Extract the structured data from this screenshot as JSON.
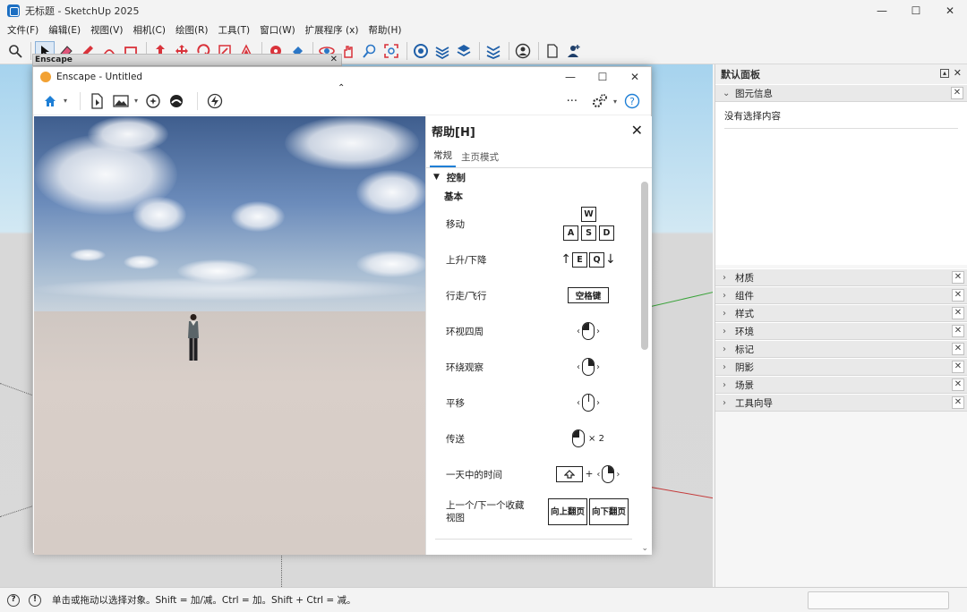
{
  "window": {
    "title": "无标题 - SketchUp 2025",
    "controls": [
      "—",
      "☐",
      "✕"
    ]
  },
  "menu": [
    "文件(F)",
    "编辑(E)",
    "视图(V)",
    "相机(C)",
    "绘图(R)",
    "工具(T)",
    "窗口(W)",
    "扩展程序 (x)",
    "帮助(H)"
  ],
  "toolbar_icons": [
    "magnifier-icon",
    "select-arrow-icon",
    "eraser-icon",
    "pencil-icon",
    "arc-icon",
    "rectangle-icon",
    "pushpull-icon",
    "move-icon",
    "rotate-icon",
    "scale-icon",
    "offset-icon",
    "tape-icon",
    "paint-icon",
    "orbit-icon",
    "pan-icon",
    "zoom-icon",
    "zoom-extents-icon",
    "warehouse-icon",
    "extension-icon",
    "layers-icon",
    "stack-icon",
    "user-icon",
    "document-icon",
    "add-user-icon"
  ],
  "enscape_mini": {
    "title": "Enscape"
  },
  "enscape": {
    "title": "Enscape - Untitled",
    "more": "···",
    "help": {
      "title": "帮助[H]",
      "tabs": [
        "常规",
        "主页模式"
      ],
      "section": "控制",
      "subsection": "基本",
      "rows": [
        {
          "label": "移动",
          "keys": [
            "W",
            "A",
            "S",
            "D"
          ]
        },
        {
          "label": "上升/下降",
          "keys": [
            "E",
            "Q"
          ]
        },
        {
          "label": "行走/飞行",
          "keys": [
            "空格键"
          ]
        },
        {
          "label": "环视四周"
        },
        {
          "label": "环绕观察"
        },
        {
          "label": "平移"
        },
        {
          "label": "传送",
          "suffix": "× 2"
        },
        {
          "label": "一天中的时间",
          "plus": "+"
        },
        {
          "label": "上一个/下一个收藏视图",
          "keys": [
            "向上翻页",
            "向下翻页"
          ]
        }
      ]
    }
  },
  "tray": {
    "title": "默认面板",
    "entity_info": {
      "label": "图元信息",
      "content": "没有选择内容"
    },
    "sections": [
      "材质",
      "组件",
      "样式",
      "环境",
      "标记",
      "阴影",
      "场景",
      "工具向导"
    ]
  },
  "status": {
    "text": "单击或拖动以选择对象。Shift = 加/减。Ctrl = 加。Shift + Ctrl = 减。"
  },
  "colors": {
    "accent": "#1e7fd6",
    "sky_top": "#3f5e8e",
    "ground": "#d6ccc6"
  }
}
